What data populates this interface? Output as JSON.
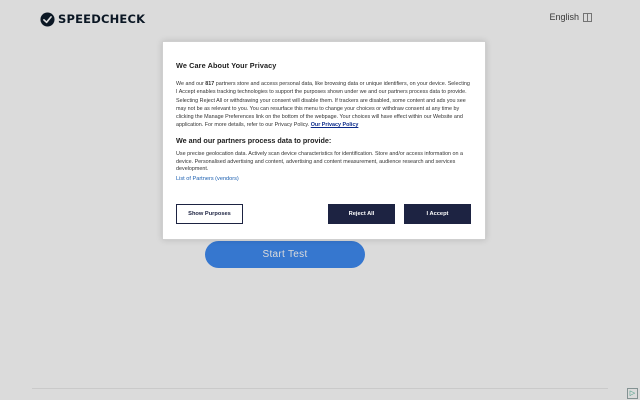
{
  "header": {
    "brand": "SPEEDCHECK",
    "language": "English"
  },
  "main": {
    "start_button": "Start Test"
  },
  "consent": {
    "title": "We Care About Your Privacy",
    "intro_before_count": "We and our ",
    "partner_count": "817",
    "intro_after_count": " partners store and access personal data, like browsing data or unique identifiers, on your device. Selecting I Accept enables tracking technologies to support the purposes shown under we and our partners process data to provide. Selecting Reject All or withdrawing your consent will disable them. If trackers are disabled, some content and ads you see may not be as relevant to you. You can resurface this menu to change your choices or withdraw consent at any time by clicking the Manage Preferences link on the bottom of the webpage. Your choices will have effect within our Website and application. For more details, refer to our Privacy Policy. ",
    "privacy_link": "Our Privacy Policy",
    "subtitle": "We and our partners process data to provide:",
    "purposes": "Use precise geolocation data. Actively scan device characteristics for identification. Store and/or access information on a device. Personalised advertising and content, advertising and content measurement, audience research and services development.",
    "partners_link": "List of Partners (vendors)",
    "buttons": {
      "show_purposes": "Show Purposes",
      "reject_all": "Reject All",
      "accept": "I Accept"
    }
  },
  "colors": {
    "brand_dark": "#0d1b2a",
    "primary_button": "#3f8bf2",
    "consent_button": "#1d2342",
    "link": "#1b5fb0"
  },
  "icons": {
    "logo": "speedometer-check-icon",
    "language": "globe-box-icon",
    "ad_choices": "adchoices-icon"
  }
}
